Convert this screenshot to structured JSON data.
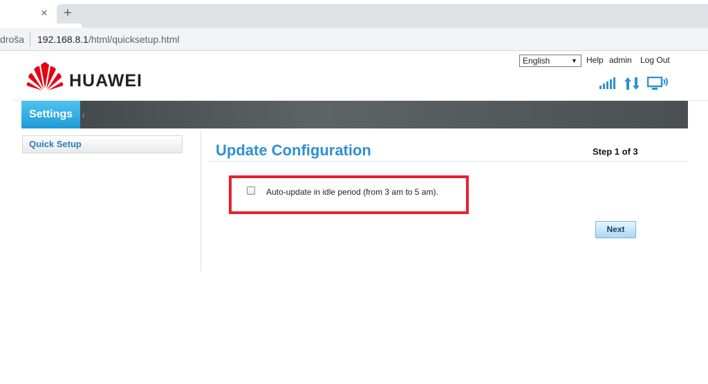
{
  "browser": {
    "new_tab_glyph": "+",
    "close_tab_glyph": "×",
    "address_prefix": "droša",
    "address_host": "192.168.8.1",
    "address_path": "/html/quicksetup.html"
  },
  "header": {
    "brand": "HUAWEI",
    "language": "English",
    "links": {
      "help": "Help",
      "user": "admin",
      "logout": "Log Out"
    },
    "status_icons": [
      "signal-strength-icon",
      "data-transfer-icon",
      "device-connected-icon"
    ]
  },
  "nav": {
    "active_tab": "Settings"
  },
  "sidebar": {
    "items": [
      {
        "label": "Quick Setup"
      }
    ]
  },
  "main": {
    "title": "Update Configuration",
    "step": "Step 1 of 3",
    "auto_update_label": "Auto-update in idle period (from 3 am to 5 am).",
    "auto_update_checked": false,
    "next_label": "Next"
  },
  "colors": {
    "accent_blue": "#2f8fd4",
    "nav_active": "#1e9ad6",
    "highlight_red": "#e8202e",
    "logo_red": "#e60012"
  }
}
